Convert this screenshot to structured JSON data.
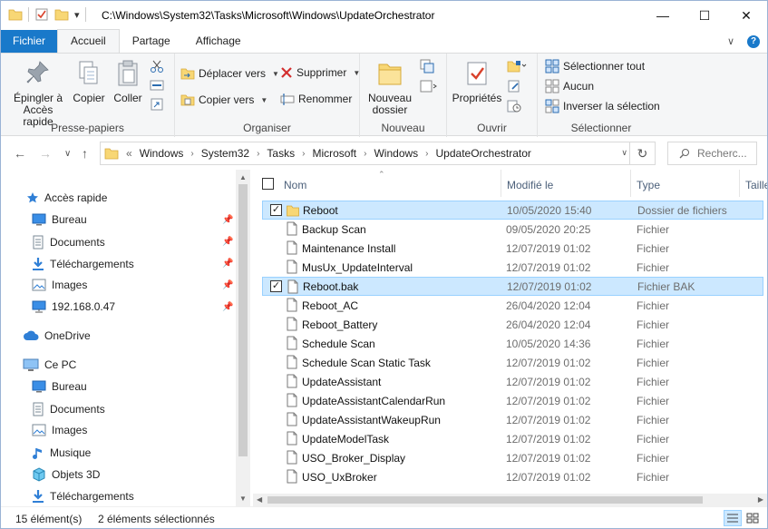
{
  "window": {
    "title": "C:\\Windows\\System32\\Tasks\\Microsoft\\Windows\\UpdateOrchestrator",
    "qat_dropdown": "▾",
    "minimize": "—",
    "maximize": "☐",
    "close": "✕"
  },
  "ribbon_tabs": [
    {
      "label": "Fichier"
    },
    {
      "label": "Accueil"
    },
    {
      "label": "Partage"
    },
    {
      "label": "Affichage"
    }
  ],
  "ribbon_right": {
    "collapse": "∨",
    "help": "?"
  },
  "ribbon": {
    "clipboard": {
      "label": "Presse-papiers",
      "pin_quick": "Épingler à\nAccès rapide",
      "copy": "Copier",
      "paste": "Coller"
    },
    "organize": {
      "label": "Organiser",
      "move_to": "Déplacer vers",
      "copy_to": "Copier vers",
      "delete": "Supprimer",
      "rename": "Renommer"
    },
    "new": {
      "label": "Nouveau",
      "new_folder": "Nouveau\ndossier"
    },
    "open": {
      "label": "Ouvrir",
      "properties": "Propriétés"
    },
    "select": {
      "label": "Sélectionner",
      "select_all": "Sélectionner tout",
      "select_none": "Aucun",
      "invert": "Inverser la sélection"
    }
  },
  "address": {
    "back": "←",
    "forward": "→",
    "recent": "∨",
    "up": "↑",
    "overflow": "«",
    "crumbs": [
      "Windows",
      "System32",
      "Tasks",
      "Microsoft",
      "Windows",
      "UpdateOrchestrator"
    ],
    "crumb_sep": "›",
    "dropdown": "∨",
    "refresh": "↻",
    "search_placeholder": "Recherc..."
  },
  "nav": {
    "quick_access": "Accès rapide",
    "quick_items": [
      "Bureau",
      "Documents",
      "Téléchargements",
      "Images",
      "192.168.0.47"
    ],
    "onedrive": "OneDrive",
    "this_pc": "Ce PC",
    "pc_items": [
      "Bureau",
      "Documents",
      "Images",
      "Musique",
      "Objets 3D",
      "Téléchargements"
    ],
    "pin_glyph": "📌"
  },
  "columns": {
    "name": "Nom",
    "modified": "Modifié le",
    "type": "Type",
    "size": "Taille"
  },
  "files": [
    {
      "name": "Reboot",
      "date": "10/05/2020 15:40",
      "type": "Dossier de fichiers",
      "selected": true,
      "folder": true
    },
    {
      "name": "Backup Scan",
      "date": "09/05/2020 20:25",
      "type": "Fichier",
      "selected": false,
      "folder": false
    },
    {
      "name": "Maintenance Install",
      "date": "12/07/2019 01:02",
      "type": "Fichier",
      "selected": false,
      "folder": false
    },
    {
      "name": "MusUx_UpdateInterval",
      "date": "12/07/2019 01:02",
      "type": "Fichier",
      "selected": false,
      "folder": false
    },
    {
      "name": "Reboot.bak",
      "date": "12/07/2019 01:02",
      "type": "Fichier BAK",
      "selected": true,
      "folder": false
    },
    {
      "name": "Reboot_AC",
      "date": "26/04/2020 12:04",
      "type": "Fichier",
      "selected": false,
      "folder": false
    },
    {
      "name": "Reboot_Battery",
      "date": "26/04/2020 12:04",
      "type": "Fichier",
      "selected": false,
      "folder": false
    },
    {
      "name": "Schedule Scan",
      "date": "10/05/2020 14:36",
      "type": "Fichier",
      "selected": false,
      "folder": false
    },
    {
      "name": "Schedule Scan Static Task",
      "date": "12/07/2019 01:02",
      "type": "Fichier",
      "selected": false,
      "folder": false
    },
    {
      "name": "UpdateAssistant",
      "date": "12/07/2019 01:02",
      "type": "Fichier",
      "selected": false,
      "folder": false
    },
    {
      "name": "UpdateAssistantCalendarRun",
      "date": "12/07/2019 01:02",
      "type": "Fichier",
      "selected": false,
      "folder": false
    },
    {
      "name": "UpdateAssistantWakeupRun",
      "date": "12/07/2019 01:02",
      "type": "Fichier",
      "selected": false,
      "folder": false
    },
    {
      "name": "UpdateModelTask",
      "date": "12/07/2019 01:02",
      "type": "Fichier",
      "selected": false,
      "folder": false
    },
    {
      "name": "USO_Broker_Display",
      "date": "12/07/2019 01:02",
      "type": "Fichier",
      "selected": false,
      "folder": false
    },
    {
      "name": "USO_UxBroker",
      "date": "12/07/2019 01:02",
      "type": "Fichier",
      "selected": false,
      "folder": false
    }
  ],
  "status": {
    "count": "15 élément(s)",
    "selected": "2 éléments sélectionnés"
  },
  "colors": {
    "accent": "#1979ca",
    "selection": "#cce8ff",
    "selection_border": "#99d1ff",
    "folder": "#f8d775"
  }
}
